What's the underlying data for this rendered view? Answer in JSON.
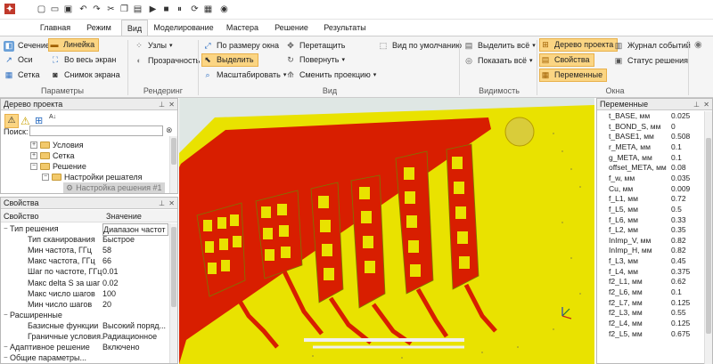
{
  "window": {
    "accent": "#c0392b",
    "pcb_board": "#e9e200",
    "pcb_copper": "#d81e00"
  },
  "menu_tabs": [
    "Главная",
    "Режим",
    "Вид",
    "Моделирование",
    "Мастера",
    "Решение",
    "Результаты"
  ],
  "active_tab": "Вид",
  "ribbon": {
    "params": {
      "section": "Сечение",
      "ruler": "Линейка",
      "axes": "Оси",
      "fullscreen": "Во весь экран",
      "grid": "Сетка",
      "screenshot": "Снимок экрана",
      "group": "Параметры"
    },
    "render": {
      "nodes": "Узлы",
      "transparency": "Прозрачность",
      "group": "Рендеринг"
    },
    "view": {
      "fit": "По размеру окна",
      "select": "Выделить",
      "zoom": "Масштабировать",
      "drag": "Перетащить",
      "rotate": "Повернуть",
      "projection": "Сменить проекцию",
      "default": "Вид по умолчанию",
      "group": "Вид"
    },
    "visibility": {
      "select_all": "Выделить всё",
      "show_all": "Показать всё",
      "group": "Видимость"
    },
    "windows": {
      "tree": "Дерево проекта",
      "props": "Свойства",
      "vars": "Переменные",
      "log": "Журнал событий",
      "status": "Статус решения",
      "group": "Окна"
    }
  },
  "project_tree": {
    "title": "Дерево проекта",
    "search_label": "Поиск:",
    "items": [
      "Условия",
      "Сетка",
      "Решение",
      "Настройки решателя",
      "Настройка решения #1"
    ]
  },
  "properties": {
    "title": "Свойства",
    "col_prop": "Свойство",
    "col_val": "Значение",
    "rows": [
      {
        "k": "Тип решения",
        "v": "Диапазон частот",
        "level": 0
      },
      {
        "k": "Тип сканирования",
        "v": "Быстрое",
        "level": 1
      },
      {
        "k": "Мин частота, ГГц",
        "v": "58",
        "level": 1
      },
      {
        "k": "Макс частота, ГГц",
        "v": "66",
        "level": 1
      },
      {
        "k": "Шаг по частоте, ГГц",
        "v": "0.01",
        "level": 1
      },
      {
        "k": "Макс delta S за шаг",
        "v": "0.02",
        "level": 1
      },
      {
        "k": "Макс число шагов",
        "v": "100",
        "level": 1
      },
      {
        "k": "Мин число шагов",
        "v": "20",
        "level": 1
      },
      {
        "k": "Расширенные",
        "v": "",
        "level": 0
      },
      {
        "k": "Базисные функции",
        "v": "Высокий поряд...",
        "level": 1
      },
      {
        "k": "Граничные условия...",
        "v": "Радиационное",
        "level": 1
      },
      {
        "k": "Адаптивное решение",
        "v": "Включено",
        "level": 0
      },
      {
        "k": "Общие параметры...",
        "v": "",
        "level": 0
      }
    ]
  },
  "variables": {
    "title": "Переменные",
    "rows": [
      {
        "k": "t_BASE, мм",
        "v": "0.025"
      },
      {
        "k": "t_BOND_S, мм",
        "v": "0"
      },
      {
        "k": "t_BASE1, мм",
        "v": "0.508"
      },
      {
        "k": "r_META, мм",
        "v": "0.1"
      },
      {
        "k": "g_META, мм",
        "v": "0.1"
      },
      {
        "k": "offset_META, мм",
        "v": "0.08"
      },
      {
        "k": "f_w, мм",
        "v": "0.035"
      },
      {
        "k": "Cu, мм",
        "v": "0.009"
      },
      {
        "k": "f_L1, мм",
        "v": "0.72"
      },
      {
        "k": "f_L5, мм",
        "v": "0.5"
      },
      {
        "k": "f_L6, мм",
        "v": "0.33"
      },
      {
        "k": "f_L2, мм",
        "v": "0.35"
      },
      {
        "k": "InImp_V, мм",
        "v": "0.82"
      },
      {
        "k": "InImp_H, мм",
        "v": "0.82"
      },
      {
        "k": "f_L3, мм",
        "v": "0.45"
      },
      {
        "k": "f_L4, мм",
        "v": "0.375"
      },
      {
        "k": "f2_L1, мм",
        "v": "0.62"
      },
      {
        "k": "f2_L6, мм",
        "v": "0.1"
      },
      {
        "k": "f2_L7, мм",
        "v": "0.125"
      },
      {
        "k": "f2_L3, мм",
        "v": "0.55"
      },
      {
        "k": "f2_L4, мм",
        "v": "0.125"
      },
      {
        "k": "f2_L5, мм",
        "v": "0.675"
      }
    ]
  }
}
